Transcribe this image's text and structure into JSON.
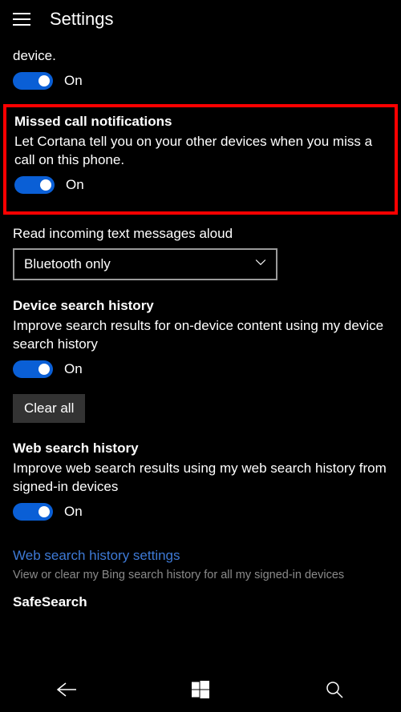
{
  "header": {
    "title": "Settings"
  },
  "fragment": {
    "text": "device."
  },
  "toggle1": {
    "state": "On"
  },
  "missedCall": {
    "title": "Missed call notifications",
    "desc": "Let Cortana tell you on your other devices when you miss a call on this phone.",
    "state": "On"
  },
  "readAloud": {
    "label": "Read incoming text messages aloud",
    "selected": "Bluetooth only"
  },
  "deviceHistory": {
    "title": "Device search history",
    "desc": "Improve search results for on-device content using my device search history",
    "state": "On",
    "clearBtn": "Clear all"
  },
  "webHistory": {
    "title": "Web search history",
    "desc": "Improve web search results using my web search history from signed-in devices",
    "state": "On",
    "link": "Web search history settings",
    "linkDesc": "View or clear my Bing search history for all my signed-in devices"
  },
  "safeSearch": {
    "title": "SafeSearch"
  }
}
